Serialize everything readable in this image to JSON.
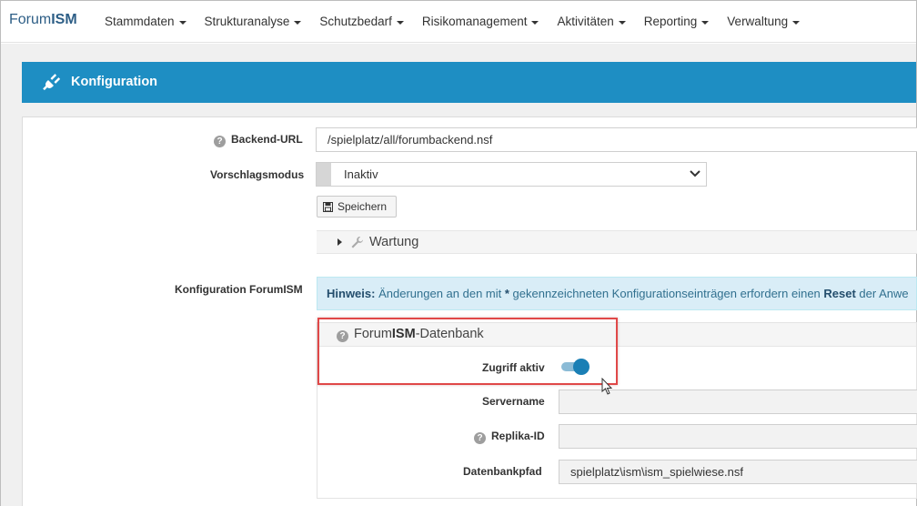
{
  "brand": {
    "prefix": "Forum",
    "bold": "ISM"
  },
  "nav": [
    {
      "label": "Stammdaten"
    },
    {
      "label": "Strukturanalyse"
    },
    {
      "label": "Schutzbedarf"
    },
    {
      "label": "Risikomanagement"
    },
    {
      "label": "Aktivitäten"
    },
    {
      "label": "Reporting"
    },
    {
      "label": "Verwaltung"
    }
  ],
  "panel": {
    "title": "Konfiguration",
    "icon": "plug-icon"
  },
  "form": {
    "backend_url": {
      "label": "Backend-URL",
      "value": "/spielplatz/all/forumbackend.nsf"
    },
    "vorschlagsmodus": {
      "label": "Vorschlagsmodus",
      "value": "Inaktiv"
    },
    "save_label": "Speichern",
    "wartung_label": "Wartung",
    "config_label": "Konfiguration ForumISM"
  },
  "alert": {
    "hint": "Hinweis:",
    "text1": " Änderungen an den mit ",
    "star": "*",
    "text2": " gekennzeichneten Konfigurationseinträgen erfordern einen ",
    "reset": "Reset",
    "text3": " der Anwe"
  },
  "db": {
    "title_prefix": "Forum",
    "title_bold": "ISM",
    "title_suffix": "-Datenbank",
    "zugriff_label": "Zugriff aktiv",
    "zugriff_on": true,
    "servername_label": "Servername",
    "servername_value": "",
    "replika_label": "Replika-ID",
    "replika_value": "",
    "pfad_label": "Datenbankpfad",
    "pfad_value": "spielplatz\\ism\\ism_spielwiese.nsf"
  },
  "colors": {
    "header_blue": "#1e8ec3",
    "brand": "#2d5e86",
    "highlight": "#e04848",
    "toggle": "#1a7fb5"
  }
}
